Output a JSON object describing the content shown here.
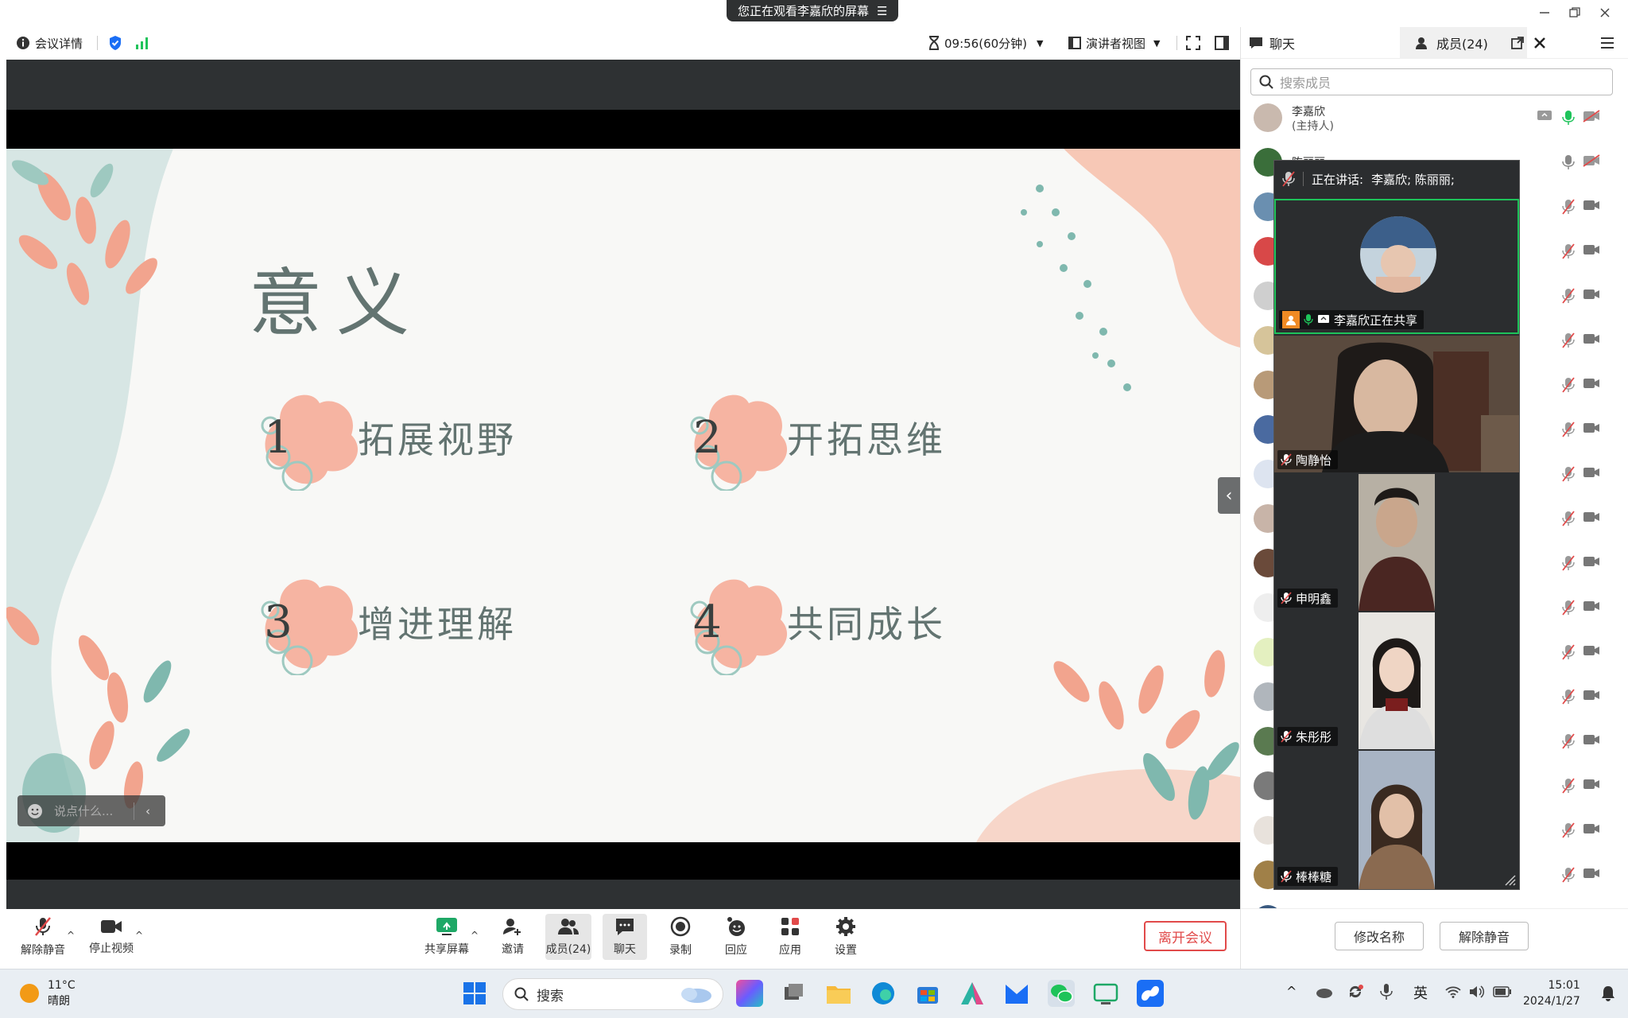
{
  "banner": {
    "text": "您正在观看李嘉欣的屏幕"
  },
  "header": {
    "meeting_details": "会议详情",
    "timer": "09:56(60分钟)",
    "view_mode": "演讲者视图"
  },
  "slide": {
    "title": "意义",
    "items": [
      {
        "num": "1",
        "label": "拓展视野"
      },
      {
        "num": "2",
        "label": "开拓思维"
      },
      {
        "num": "3",
        "label": "增进理解"
      },
      {
        "num": "4",
        "label": "共同成长"
      }
    ]
  },
  "comment": {
    "placeholder": "说点什么..."
  },
  "toolbar": {
    "unmute": "解除静音",
    "stop_video": "停止视频",
    "share_screen": "共享屏幕",
    "invite": "邀请",
    "members": "成员(24)",
    "chat": "聊天",
    "record": "录制",
    "reactions": "回应",
    "apps": "应用",
    "settings": "设置",
    "leave": "离开会议"
  },
  "panel": {
    "tab_chat": "聊天",
    "tab_members": "成员(24)",
    "search_placeholder": "搜索成员",
    "host_name": "李嘉欣",
    "host_role": "(主持人)",
    "second_name": "陈丽丽",
    "rename": "修改名称",
    "unmute": "解除静音"
  },
  "gallery": {
    "speaking_prefix": "正在讲话:",
    "speaking_names": "李嘉欣; 陈丽丽;",
    "tiles": [
      {
        "label": "李嘉欣正在共享"
      },
      {
        "label": "陶静怡"
      },
      {
        "label": "申明鑫"
      },
      {
        "label": "朱彤彤"
      },
      {
        "label": "棒棒糖"
      }
    ]
  },
  "taskbar": {
    "temperature": "11°C",
    "weather": "晴朗",
    "search": "搜索",
    "ime": "英",
    "time": "15:01",
    "date": "2024/1/27"
  },
  "colors": {
    "accent": "#1a6ef5",
    "leave": "#e14a4a",
    "speaking": "#1ec35a",
    "muted": "#e14a4a"
  }
}
